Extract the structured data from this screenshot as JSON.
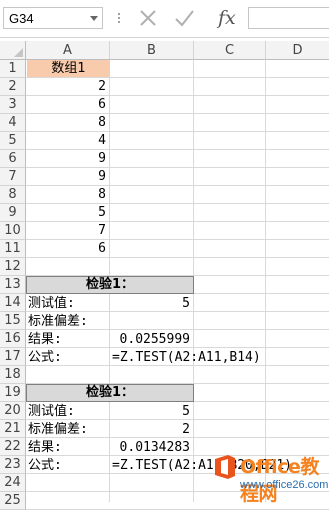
{
  "formula_bar": {
    "name_box": "G34",
    "cancel_icon": "x-icon",
    "enter_icon": "check-icon",
    "fx_label": "fx",
    "formula": ""
  },
  "columns": [
    "A",
    "B",
    "C",
    "D"
  ],
  "rows": [
    "1",
    "2",
    "3",
    "4",
    "5",
    "6",
    "7",
    "8",
    "9",
    "10",
    "11",
    "12",
    "13",
    "14",
    "15",
    "16",
    "17",
    "18",
    "19",
    "20",
    "21",
    "22",
    "23",
    "24",
    "25"
  ],
  "cells": {
    "a1": "数组1",
    "data": [
      "2",
      "6",
      "8",
      "4",
      "9",
      "9",
      "8",
      "5",
      "7",
      "6"
    ],
    "test1": {
      "header": "检验1：",
      "label_test": "测试值:",
      "value_test": "5",
      "label_sd": "标准偏差:",
      "value_sd": "",
      "label_result": "结果:",
      "value_result": "0.0255999",
      "label_formula": "公式:",
      "value_formula": "=Z.TEST(A2:A11,B14)"
    },
    "test2": {
      "header": "检验1：",
      "label_test": "测试值:",
      "value_test": "5",
      "label_sd": "标准偏差:",
      "value_sd": "2",
      "label_result": "结果:",
      "value_result": "0.0134283",
      "label_formula": "公式:",
      "value_formula": "=Z.TEST(A2:A11,B20,B21)"
    }
  },
  "watermark": {
    "brand": "Office教程网",
    "url": "www.office26.com"
  }
}
